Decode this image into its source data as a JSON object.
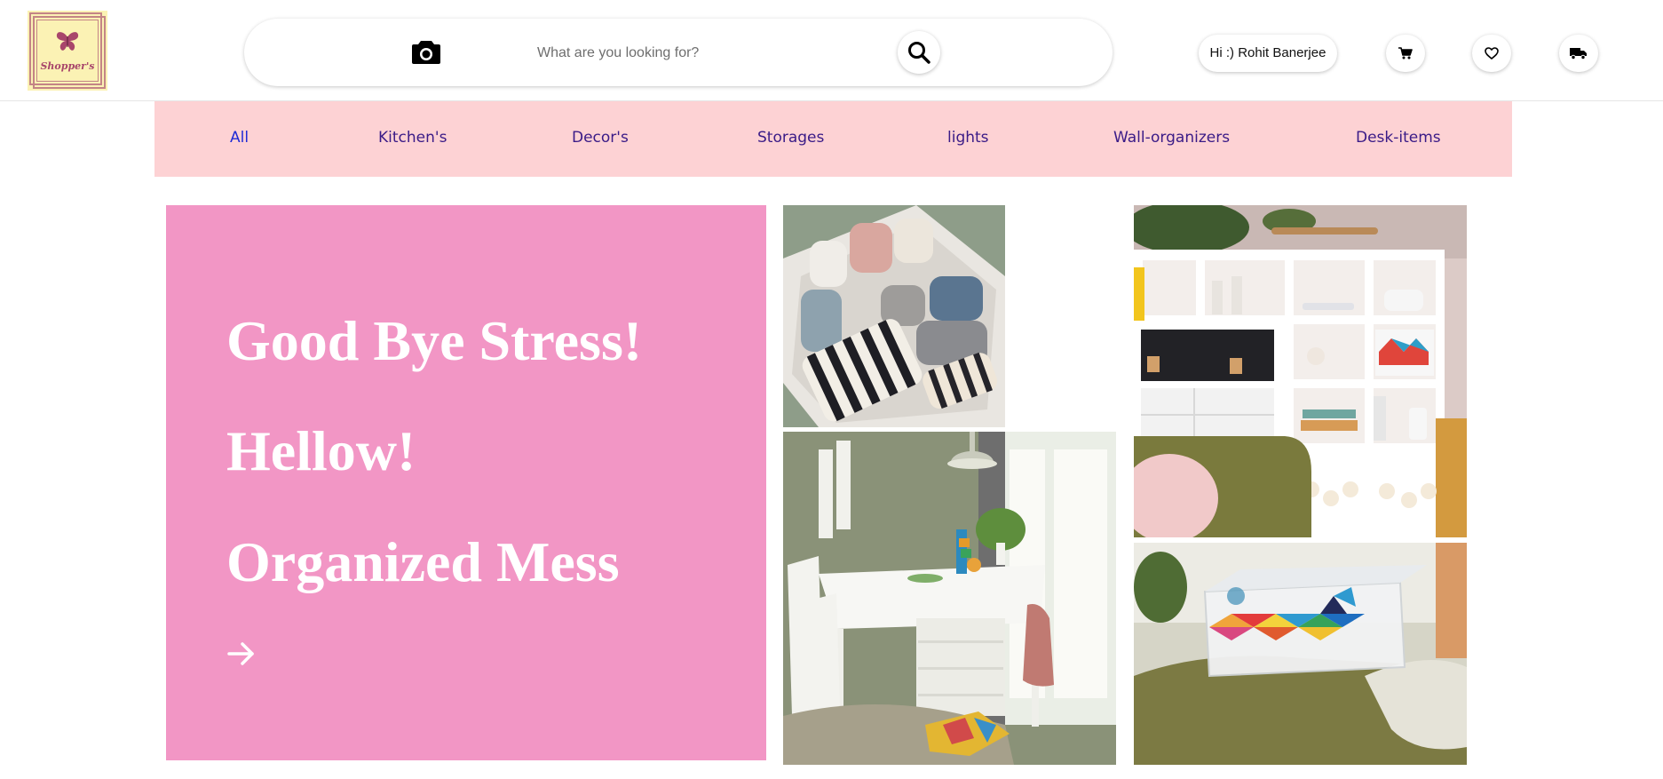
{
  "brand": {
    "name": "Shopper's"
  },
  "search": {
    "placeholder": "What are you looking for?"
  },
  "user": {
    "greeting": "Hi :) Rohit Banerjee"
  },
  "icons": {
    "camera": "camera-icon",
    "search": "search-icon",
    "cart": "cart-icon",
    "wishlist": "heart-icon",
    "delivery": "truck-icon",
    "hero_arrow": "arrow-right-icon"
  },
  "categories": [
    {
      "label": "All",
      "active": true
    },
    {
      "label": "Kitchen's",
      "active": false
    },
    {
      "label": "Decor's",
      "active": false
    },
    {
      "label": "Storages",
      "active": false
    },
    {
      "label": "lights",
      "active": false
    },
    {
      "label": "Wall-organizers",
      "active": false
    },
    {
      "label": "Desk-items",
      "active": false
    }
  ],
  "hero": {
    "lines": [
      "Good Bye Stress!",
      "Hellow!",
      "Organized Mess"
    ]
  },
  "colors": {
    "nav_background": "#fdd2d4",
    "nav_text": "#3a1b87",
    "nav_active": "#1f2bd6",
    "hero_background": "#f296c5",
    "hero_text": "#ffffff",
    "logo_background": "#fbf2b4",
    "logo_accent": "#a8466b"
  }
}
